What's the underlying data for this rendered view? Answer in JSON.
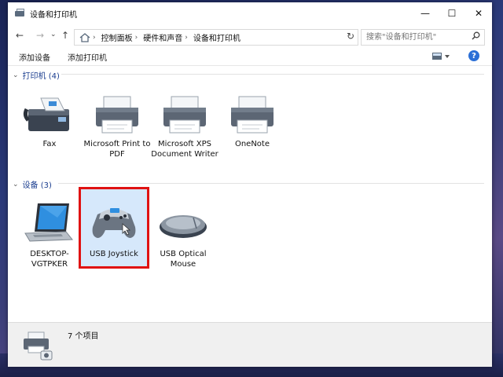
{
  "window": {
    "title": "设备和打印机",
    "controls": {
      "minimize": "—",
      "maximize": "☐",
      "close": "✕"
    }
  },
  "nav": {
    "back": "←",
    "forward": "→",
    "dropdown": "⌄",
    "up": "↑",
    "breadcrumb": [
      "控制面板",
      "硬件和声音",
      "设备和打印机"
    ],
    "search_placeholder": "搜索\"设备和打印机\""
  },
  "commands": {
    "add_device": "添加设备",
    "add_printer": "添加打印机",
    "help": "?"
  },
  "groups": {
    "printers": {
      "label": "打印机 (4)",
      "items": [
        {
          "label": "Fax"
        },
        {
          "label": "Microsoft Print to PDF"
        },
        {
          "label": "Microsoft XPS Document Writer"
        },
        {
          "label": "OneNote"
        }
      ]
    },
    "devices": {
      "label": "设备 (3)",
      "items": [
        {
          "label": "DESKTOP-VGTPKER"
        },
        {
          "label": "USB Joystick"
        },
        {
          "label": "USB Optical Mouse"
        }
      ]
    }
  },
  "status": {
    "count_text": "7 个项目"
  },
  "colors": {
    "selection_border": "#e01212",
    "selection_fill": "#d6e8fb",
    "group_header": "#1a3d8f"
  }
}
